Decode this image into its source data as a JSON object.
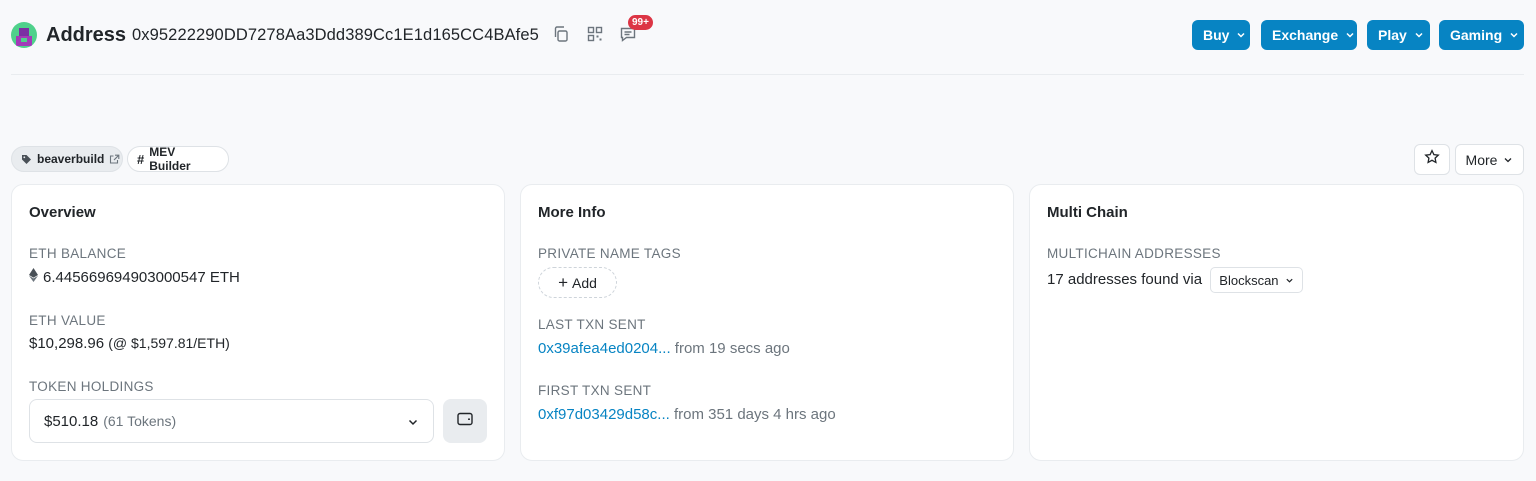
{
  "header": {
    "title": "Address",
    "address": "0x95222290DD7278Aa3Ddd389Cc1E1d165CC4BAfe5",
    "badge": "99+",
    "menu": [
      {
        "label": "Buy"
      },
      {
        "label": "Exchange"
      },
      {
        "label": "Play"
      },
      {
        "label": "Gaming"
      }
    ]
  },
  "tags": {
    "name_tag": "beaverbuild",
    "label_tag": "MEV Builder"
  },
  "actions": {
    "more_label": "More"
  },
  "overview": {
    "title": "Overview",
    "eth_balance_label": "ETH BALANCE",
    "eth_balance": "6.445669694903000547 ETH",
    "eth_value_label": "ETH VALUE",
    "eth_value": "$10,298.96",
    "eth_price": "(@ $1,597.81/ETH)",
    "token_holdings_label": "TOKEN HOLDINGS",
    "token_value": "$510.18",
    "token_count": "(61 Tokens)"
  },
  "more_info": {
    "title": "More Info",
    "private_tags_label": "PRIVATE NAME TAGS",
    "add_label": "Add",
    "last_txn_label": "LAST TXN SENT",
    "last_txn_hash": "0x39afea4ed0204...",
    "last_txn_time": "from 19 secs ago",
    "first_txn_label": "FIRST TXN SENT",
    "first_txn_hash": "0xf97d03429d58c...",
    "first_txn_time": "from 351 days 4 hrs ago"
  },
  "multi_chain": {
    "title": "Multi Chain",
    "addresses_label": "MULTICHAIN ADDRESSES",
    "found_text": "17 addresses found via",
    "source": "Blockscan"
  },
  "colors": {
    "accent": "#0784c3",
    "badge": "#dc3545",
    "muted": "#6c757d"
  }
}
